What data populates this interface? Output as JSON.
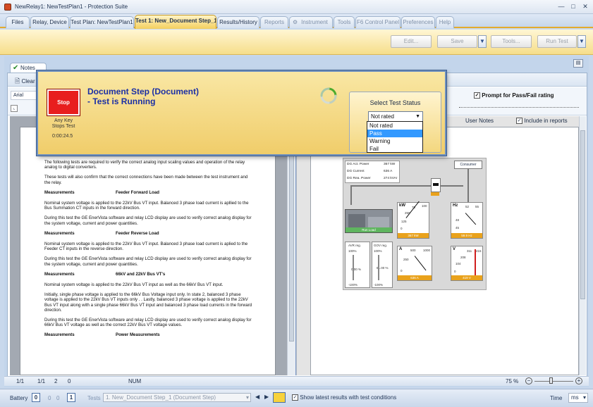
{
  "window": {
    "title": "NewRelay1: NewTestPlan1 - Protection Suite"
  },
  "tabs": [
    {
      "label": "Files"
    },
    {
      "label": "Relay, Device"
    },
    {
      "label": "Test Plan: NewTestPlan1"
    },
    {
      "label": "Test 1: New_Document Step_1"
    },
    {
      "label": "Results/History"
    },
    {
      "label": "Reports"
    },
    {
      "label": "Instrument"
    },
    {
      "label": "Tools"
    },
    {
      "label": "F6 Control Panel"
    },
    {
      "label": "Preferences"
    },
    {
      "label": "Help"
    }
  ],
  "toolbar": {
    "edit": "Edit...",
    "save": "Save",
    "tools": "Tools...",
    "run": "Run Test"
  },
  "notes_tab": "Notes",
  "editor": {
    "clear": "Clear",
    "font": "Arial",
    "prompt": "Prompt for Pass/Fail rating",
    "user_notes": "User Notes",
    "include_reports": "Include in reports"
  },
  "dialog": {
    "stop": "Stop",
    "any_key": "Any Key",
    "stops_test": "Stops Test",
    "elapsed": "0:00:24.5",
    "title1": "Document Step (Document)",
    "title2": "- Test is Running",
    "status_label": "Select Test Status",
    "status_value": "Not rated",
    "options": [
      "Not rated",
      "Pass",
      "Warning",
      "Fail"
    ],
    "selected_option": "Pass"
  },
  "document": {
    "p1": "The following tests are required to verify the correct analog input scaling values and operation of the relay analog to digital converters.",
    "p2": "These tests will also confirm that the correct connections have been made between the test instrument and the relay.",
    "h1a": "Measurements",
    "h1b": "Feeder Forward Load",
    "p3": "Nominal system voltage is applied to the 22kV Bus VT input. Balanced 3 phase load current is apllied to the Bus Summation CT inputs in the forward direction.",
    "p4": "During this test the GE EnerVista software and relay LCD display are used to verify correct analog display for the system  voltage, current and power quantities.",
    "h2a": "Measurements",
    "h2b": "Feeder Reverse Load",
    "p5": "Nominal system voltage is applied to the 22kV Bus VT input. Balanced 3 phase load current is aplied to the Feeder CT inputs in the reverse direction.",
    "p6": "During this test the GE EnerVista software and relay LCD display are used to verify correct analog display for the system  voltage, current and power quantities.",
    "h3a": "Measurements",
    "h3b": "66kV and 22kV Bus VT's",
    "p7": "Nominal system voltage is applied to the 22kV Bus VT input as well as the 66kV Bus VT input.",
    "p8": "Initially, single phase voltage is applied to the 66kV Bus Voltage input only. In state 2, balanced 3 phase voltage is applied to the 22kV Bus VT inputs only . . Lastly, balanced 3 phase voltage is applied to the 22kV Bus VT input along with a single phase  66kV Bus VT input and balanced 3 phase load currents in the forward direction.",
    "p9": "During this test the GE EnerVista software and relay LCD display are used to verify correct analog display for 66kV Bus VT voltage as well as the correct 22kV Bus VT voltage values.",
    "h4a": "Measurements",
    "h4b": "Power Measurements"
  },
  "diagram": {
    "rows": [
      {
        "label": "DG Act. Power",
        "value": "367 kW"
      },
      {
        "label": "DG Current",
        "value": "636 A"
      },
      {
        "label": "DG Rea. Power",
        "value": "274 kVAr"
      }
    ],
    "consumer": "Consumer",
    "kw": {
      "unit": "kW",
      "ticks": [
        "75",
        "100",
        "250",
        "125",
        "0",
        "-25"
      ],
      "reading": "367 kW"
    },
    "hz": {
      "unit": "Hz",
      "ticks": [
        "52",
        "55",
        "48",
        "45"
      ],
      "reading": "59.9 Hz"
    },
    "amp": {
      "unit": "A",
      "ticks": [
        "500",
        "1000",
        "250",
        "0"
      ],
      "reading": "636 A"
    },
    "volt": {
      "unit": "V",
      "ticks": [
        "311",
        "415",
        "208",
        "104",
        "0"
      ],
      "reading": "419 V"
    },
    "avr": {
      "label": "AVR reg.",
      "top": "100%",
      "mid": "0.00 %",
      "bottom": "-100%"
    },
    "gov": {
      "label": "GOV reg.",
      "top": "100%",
      "mid": "61.00 %",
      "bottom": "-100%"
    },
    "gen_status": "Run Load"
  },
  "statusbar": {
    "page": "1/1",
    "section": "1/1",
    "col": "2",
    "pos": "0",
    "num": "NUM",
    "zoom": "75 %"
  },
  "bottombar": {
    "battery": "Battery",
    "b0": "0",
    "b1": "0",
    "b2": "0",
    "b3": "1",
    "tests": "Tests",
    "test_value": "1. New_Document Step_1 (Document Step)",
    "show_latest": "Show latest results with test conditions",
    "time": "Time",
    "unit": "ms"
  },
  "colors": {
    "accent": "#f4cf5e",
    "stop": "#e81e1e",
    "title": "#1b2fa5"
  }
}
